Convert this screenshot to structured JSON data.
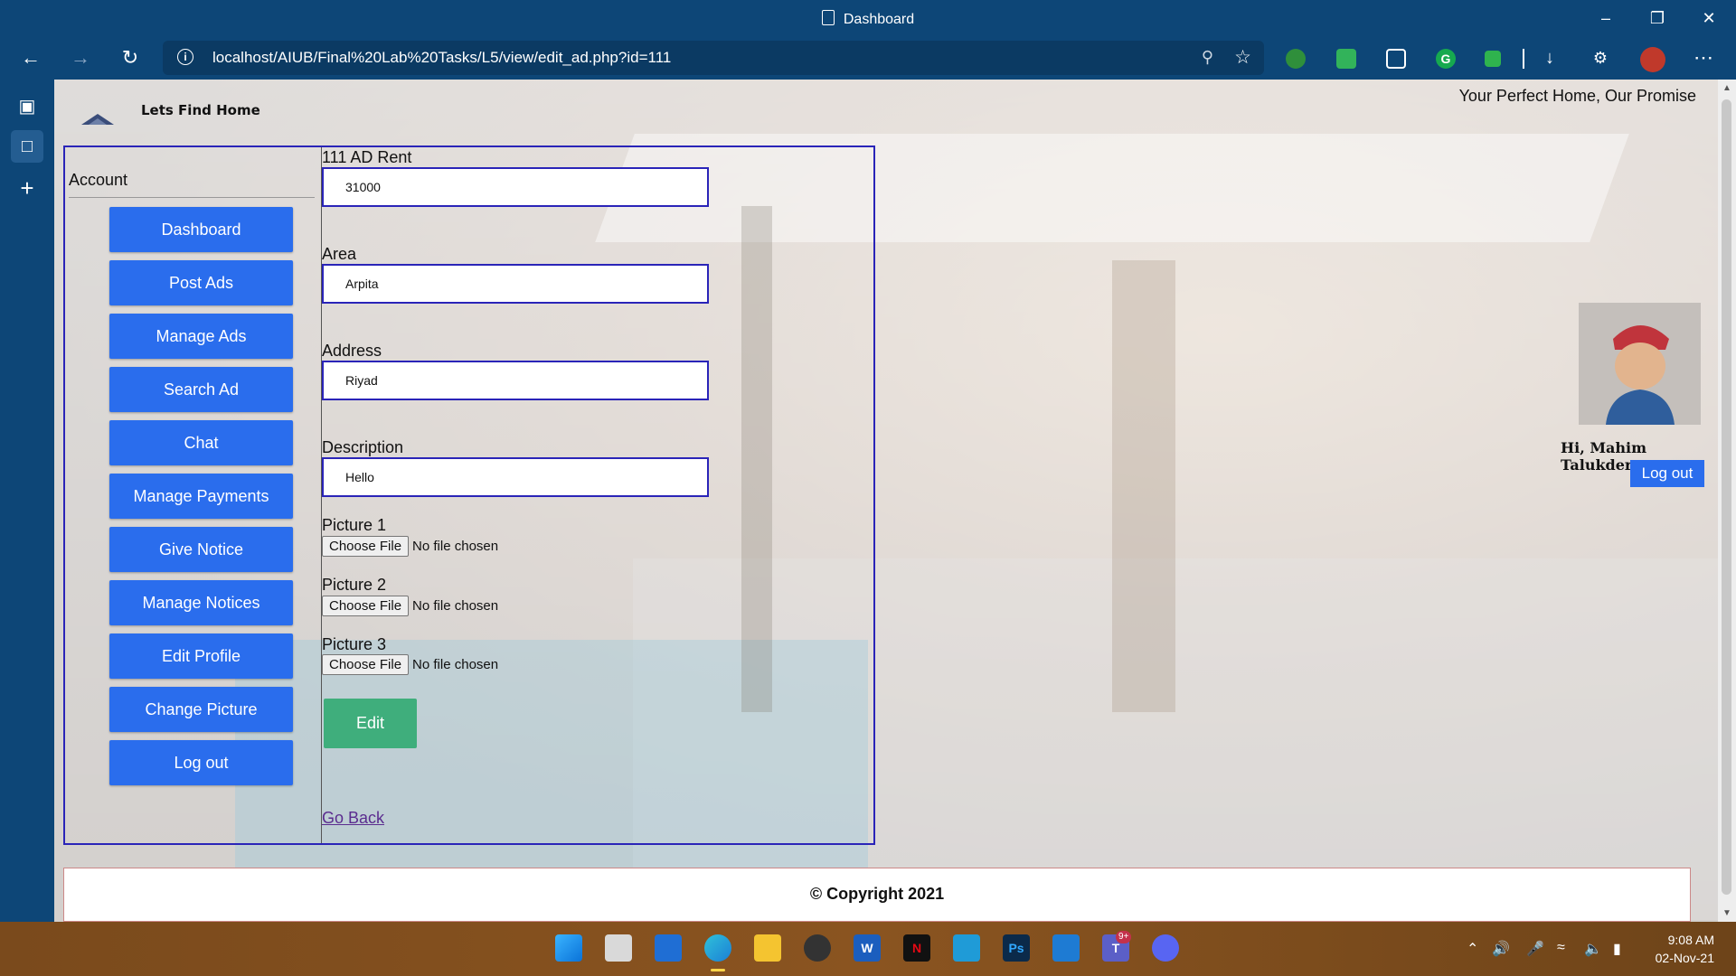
{
  "browser": {
    "window_title": "Dashboard",
    "url": "localhost/AIUB/Final%20Lab%20Tasks/L5/view/edit_ad.php?id=111"
  },
  "site": {
    "brand": "Lets Find Home",
    "slogan": "Your Perfect Home, Our Promise"
  },
  "account": {
    "title": "Account",
    "menu": [
      "Dashboard",
      "Post Ads",
      "Manage Ads",
      "Search Ad",
      "Chat",
      "Manage Payments",
      "Give Notice",
      "Manage Notices",
      "Edit Profile",
      "Change Picture",
      "Log out"
    ]
  },
  "form": {
    "rent_label": "111 AD Rent",
    "rent_value": "31000",
    "area_label": "Area",
    "area_value": "Arpita",
    "address_label": "Address",
    "address_value": "Riyad",
    "description_label": "Description",
    "description_value": "Hello",
    "pictures": [
      {
        "label": "Picture 1",
        "button": "Choose File",
        "status": "No file chosen"
      },
      {
        "label": "Picture 2",
        "button": "Choose File",
        "status": "No file chosen"
      },
      {
        "label": "Picture 3",
        "button": "Choose File",
        "status": "No file chosen"
      }
    ],
    "edit_button": "Edit",
    "go_back": "Go Back"
  },
  "profile": {
    "greeting": "Hi, Mahim Talukder",
    "logout": "Log out"
  },
  "footer": {
    "copyright": "© Copyright 2021"
  },
  "taskbar": {
    "time": "9:08 AM",
    "date": "02-Nov-21",
    "teams_badge": "9+"
  },
  "colors": {
    "menu_button": "#2a6ded",
    "edit_button": "#3fae7c",
    "border": "#2a24b8",
    "browser_chrome": "#0d4677"
  }
}
